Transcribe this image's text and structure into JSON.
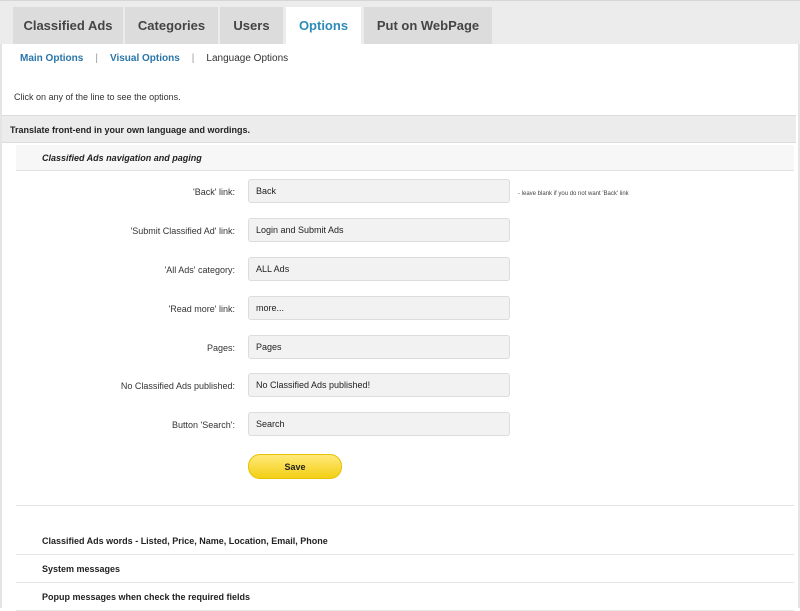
{
  "tabs": [
    {
      "label": "Classified Ads",
      "active": false
    },
    {
      "label": "Categories",
      "active": false
    },
    {
      "label": "Users",
      "active": false
    },
    {
      "label": "Options",
      "active": true
    },
    {
      "label": "Put on WebPage",
      "active": false
    }
  ],
  "subnav": {
    "main": "Main Options",
    "visual": "Visual Options",
    "language": "Language Options"
  },
  "hint": "Click on any of the line to see the options.",
  "section_title": "Translate front-end in your own language and wordings.",
  "subsection_title": "Classified Ads navigation and paging",
  "fields": [
    {
      "label": "'Back' link:",
      "value": "Back"
    },
    {
      "label": "'Submit Classified Ad' link:",
      "value": "Login and Submit Ads"
    },
    {
      "label": "'All Ads' category:",
      "value": "ALL Ads"
    },
    {
      "label": "'Read more' link:",
      "value": "more..."
    },
    {
      "label": "Pages:",
      "value": "Pages"
    },
    {
      "label": "No Classified Ads published:",
      "value": "No Classified Ads published!"
    },
    {
      "label": "Button 'Search':",
      "value": "Search"
    }
  ],
  "back_note": "- leave blank if you do not want 'Back' link",
  "save_label": "Save",
  "collapsed_sections": [
    "Classified Ads words - Listed, Price, Name, Location, Email, Phone",
    "System messages",
    "Popup messages when check the required fields"
  ],
  "colors": {
    "accent": "#2e8bb8",
    "link": "#2a75a8",
    "save": "#f3cf15"
  }
}
